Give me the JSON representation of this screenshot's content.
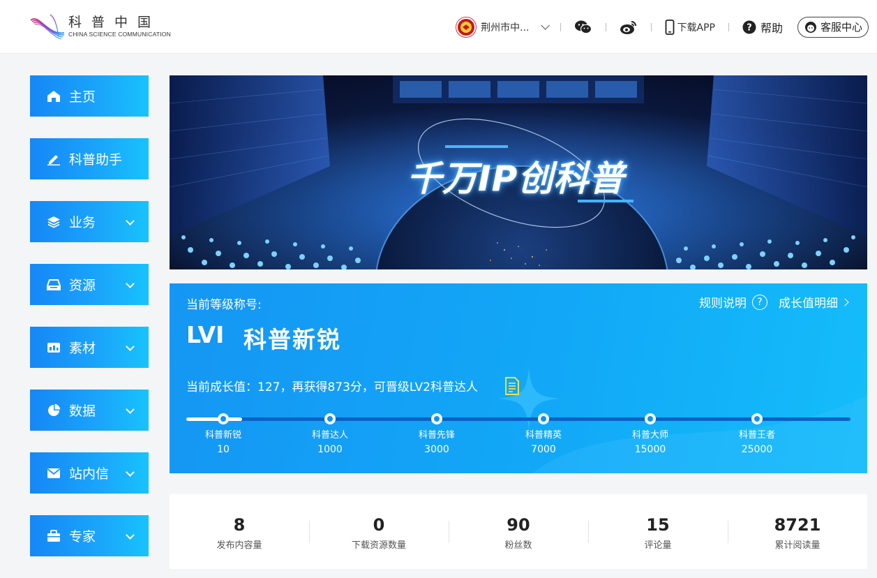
{
  "header": {
    "logo_cn": "科普中国",
    "logo_en": "CHINA SCIENCE COMMUNICATION",
    "org_name": "荆州市中...",
    "download_label": "下载APP",
    "help_label": "帮助",
    "service_label": "客服中心"
  },
  "sidebar": {
    "items": [
      {
        "label": "主页",
        "icon": "home-icon",
        "expandable": false
      },
      {
        "label": "科普助手",
        "icon": "pen-icon",
        "expandable": false
      },
      {
        "label": "业务",
        "icon": "layers-icon",
        "expandable": true
      },
      {
        "label": "资源",
        "icon": "drive-icon",
        "expandable": true
      },
      {
        "label": "素材",
        "icon": "media-icon",
        "expandable": true
      },
      {
        "label": "数据",
        "icon": "pie-chart-icon",
        "expandable": true
      },
      {
        "label": "站内信",
        "icon": "mail-icon",
        "expandable": true
      },
      {
        "label": "专家",
        "icon": "expert-icon",
        "expandable": true
      }
    ]
  },
  "banner": {
    "title": "千万IP创科普"
  },
  "level": {
    "current_label": "当前等级称号:",
    "rules_label": "规则说明",
    "growth_detail_label": "成长值明细",
    "tier": "LVI",
    "tier_name": "科普新锐",
    "growth_text": "当前成长值：127，再获得873分，可晋级LV2科普达人",
    "progress_fraction": 0.084,
    "stages": [
      {
        "label": "科普新锐",
        "value": "10"
      },
      {
        "label": "科普达人",
        "value": "1000"
      },
      {
        "label": "科普先锋",
        "value": "3000"
      },
      {
        "label": "科普精英",
        "value": "7000"
      },
      {
        "label": "科普大师",
        "value": "15000"
      },
      {
        "label": "科普王者",
        "value": "25000"
      }
    ]
  },
  "stats": [
    {
      "value": "8",
      "label": "发布内容量"
    },
    {
      "value": "0",
      "label": "下载资源数量"
    },
    {
      "value": "90",
      "label": "粉丝数"
    },
    {
      "value": "15",
      "label": "评论量"
    },
    {
      "value": "8721",
      "label": "累计阅读量"
    }
  ],
  "colors": {
    "accent_blue": "#1596f4",
    "sidebar_gradient_start": "#1687f6",
    "sidebar_gradient_end": "#18c3fc"
  }
}
